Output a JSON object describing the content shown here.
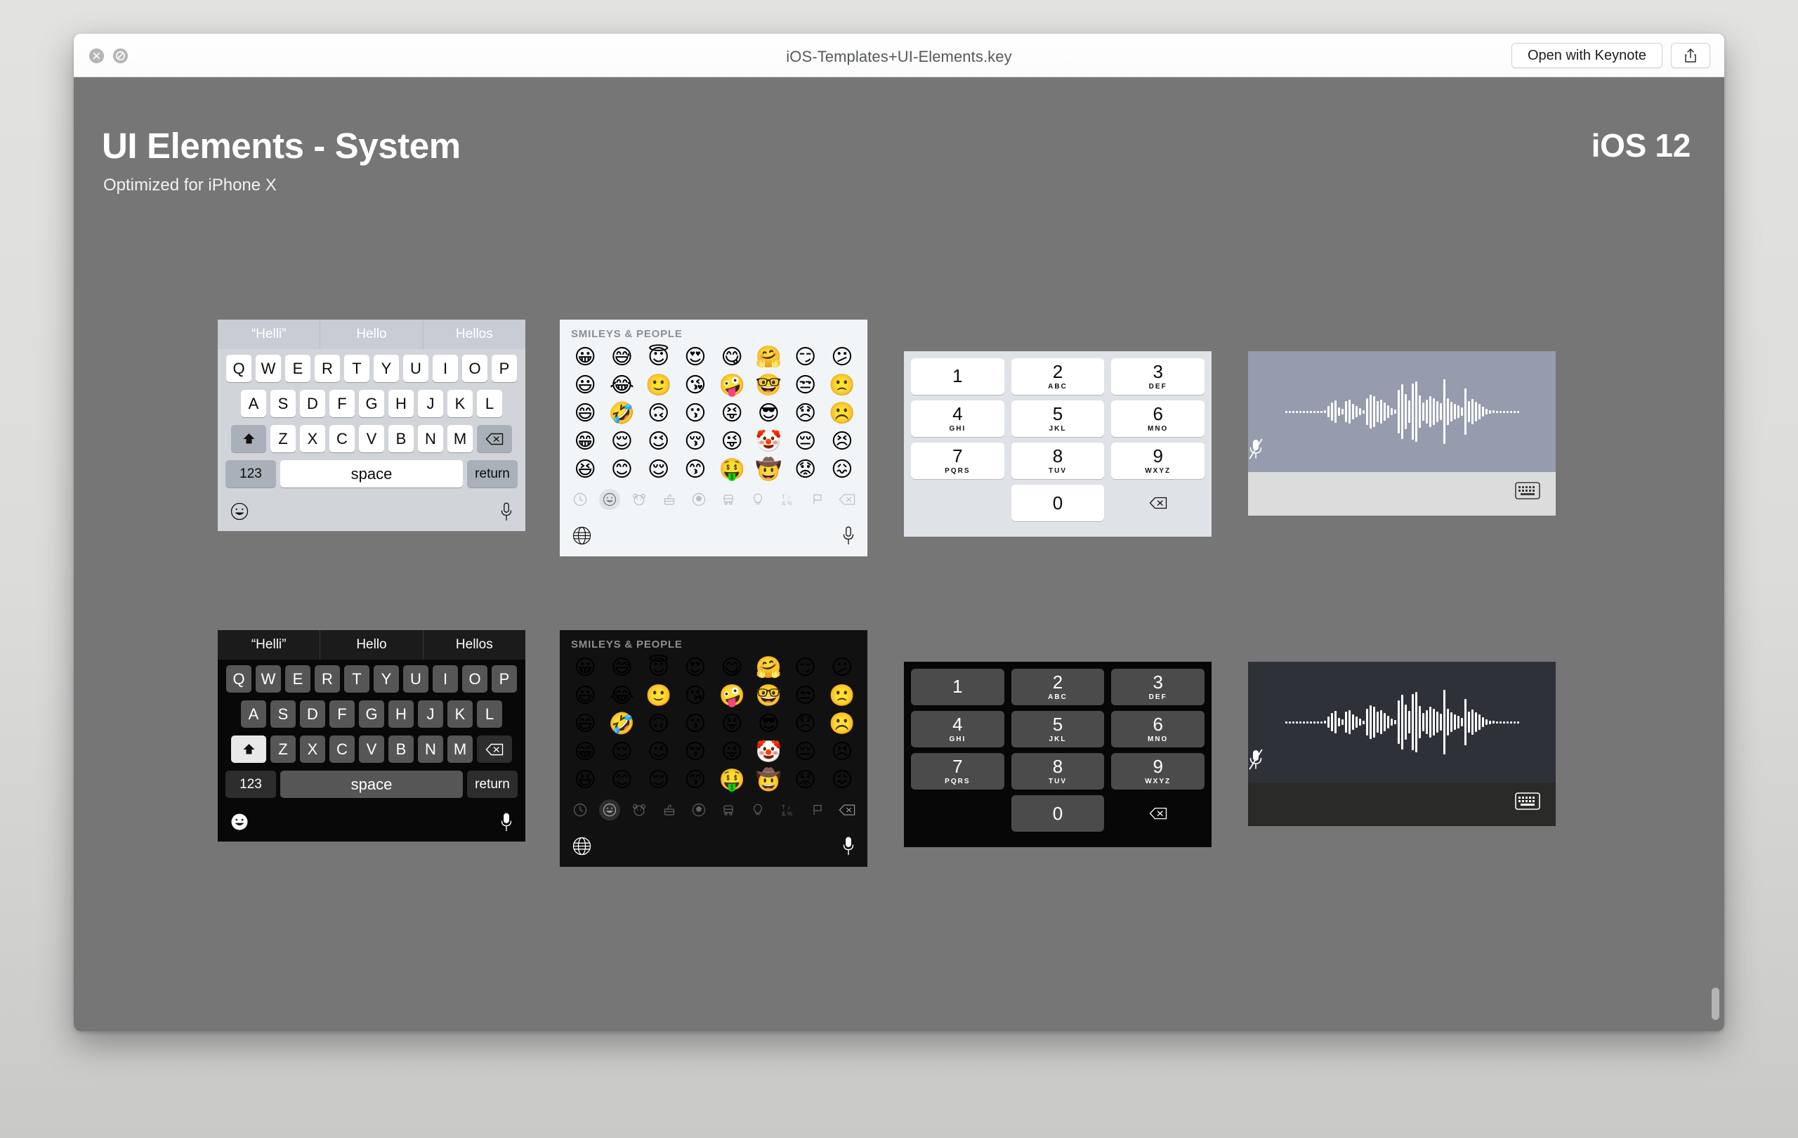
{
  "window": {
    "title": "iOS-Templates+UI-Elements.key",
    "close_label": "close",
    "disabled_label": "disabled",
    "open_with_label": "Open with Keynote",
    "share_label": "share"
  },
  "slide": {
    "title": "UI Elements - System",
    "subtitle": "Optimized for iPhone X",
    "os_badge": "iOS 12",
    "background_color": "#767676"
  },
  "keyboard": {
    "predictions": [
      "“Helli”",
      "Hello",
      "Hellos"
    ],
    "row1": [
      "Q",
      "W",
      "E",
      "R",
      "T",
      "Y",
      "U",
      "I",
      "O",
      "P"
    ],
    "row2": [
      "A",
      "S",
      "D",
      "F",
      "G",
      "H",
      "J",
      "K",
      "L"
    ],
    "row3": [
      "Z",
      "X",
      "C",
      "V",
      "B",
      "N",
      "M"
    ],
    "shift_label": "shift",
    "delete_label": "delete",
    "numbers_label": "123",
    "space_label": "space",
    "return_label": "return",
    "emoji_label": "emoji",
    "mic_label": "dictation"
  },
  "emoji": {
    "section_header": "SMILEYS & PEOPLE",
    "rows": [
      [
        "😀",
        "😅",
        "😇",
        "😍",
        "😋",
        "🤗",
        "😏",
        "😕"
      ],
      [
        "😃",
        "😂",
        "🙂",
        "😘",
        "🤪",
        "🤓",
        "😒",
        "🙁"
      ],
      [
        "😄",
        "🤣",
        "🙃",
        "😗",
        "😝",
        "😎",
        "😞",
        "☹️"
      ],
      [
        "😁",
        "😌",
        "😉",
        "😚",
        "😜",
        "🤡",
        "😔",
        "😣"
      ],
      [
        "😆",
        "😊",
        "😌",
        "😙",
        "🤑",
        "🤠",
        "😟",
        "😖"
      ]
    ],
    "tabs": [
      {
        "name": "recents",
        "active": false
      },
      {
        "name": "smileys",
        "active": true
      },
      {
        "name": "animals",
        "active": false
      },
      {
        "name": "food",
        "active": false
      },
      {
        "name": "activity",
        "active": false
      },
      {
        "name": "travel",
        "active": false
      },
      {
        "name": "objects",
        "active": false
      },
      {
        "name": "symbols",
        "active": false
      },
      {
        "name": "flags",
        "active": false
      },
      {
        "name": "delete",
        "active": false
      }
    ],
    "globe_label": "globe",
    "mic_label": "dictation"
  },
  "keypad": {
    "keys": [
      {
        "num": "1",
        "sub": ""
      },
      {
        "num": "2",
        "sub": "ABC"
      },
      {
        "num": "3",
        "sub": "DEF"
      },
      {
        "num": "4",
        "sub": "GHI"
      },
      {
        "num": "5",
        "sub": "JKL"
      },
      {
        "num": "6",
        "sub": "MNO"
      },
      {
        "num": "7",
        "sub": "PQRS"
      },
      {
        "num": "8",
        "sub": "TUV"
      },
      {
        "num": "9",
        "sub": "WXYZ"
      },
      {
        "num": "0",
        "sub": ""
      }
    ],
    "delete_label": "delete"
  },
  "dictation": {
    "mic_muted_label": "microphone-muted",
    "keyboard_label": "show-keyboard"
  },
  "scrollbar": {
    "label": "vertical-scrollbar"
  }
}
